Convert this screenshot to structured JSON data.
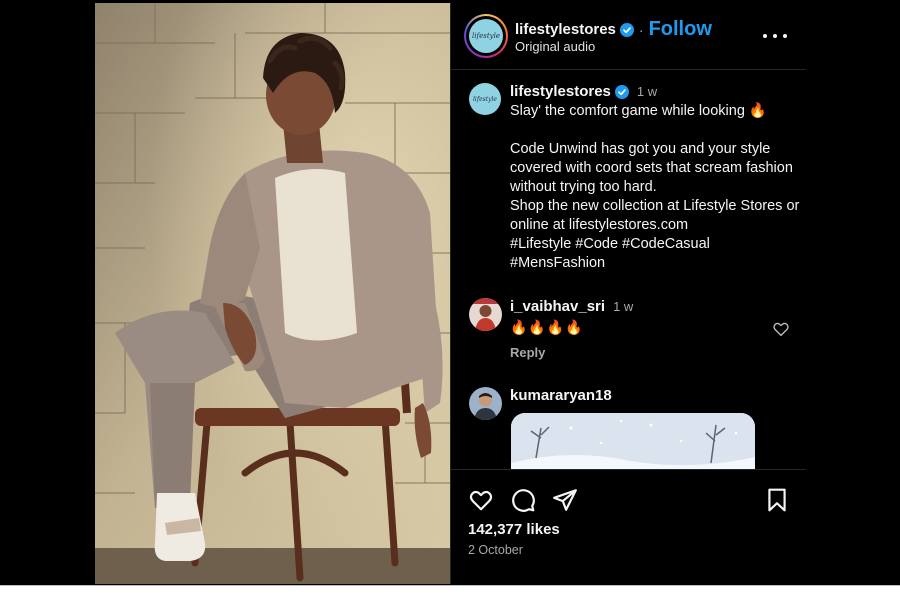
{
  "header": {
    "avatar_text": "lifestyle",
    "username": "lifestylestores",
    "separator": "·",
    "follow_label": "Follow",
    "audio": "Original audio"
  },
  "caption": {
    "avatar_text": "lifestyle",
    "username": "lifestylestores",
    "time": "1 w",
    "text": "Slay' the comfort game while looking 🔥\n\nCode Unwind has got you and your style covered with coord sets that scream fashion without trying too hard.\nShop the new collection at Lifestyle Stores or online at lifestylestores.com\n#Lifestyle #Code #CodeCasual\n#MensFashion"
  },
  "comments": [
    {
      "username": "i_vaibhav_sri",
      "time": "1 w",
      "text": "🔥🔥🔥🔥",
      "reply_label": "Reply"
    },
    {
      "username": "kumararyan18"
    }
  ],
  "actions": {
    "likes": "142,377 likes",
    "date": "2 October"
  },
  "icons": {
    "verified": "verified-badge-icon",
    "more": "more-options-icon",
    "like": "heart-icon",
    "comment": "comment-bubble-icon",
    "share": "paper-plane-icon",
    "save": "bookmark-icon"
  },
  "colors": {
    "background": "#000000",
    "accent_blue": "#1d9bf0",
    "text": "#f5f5f5",
    "muted": "#a8a8a8",
    "divider": "#262626"
  }
}
